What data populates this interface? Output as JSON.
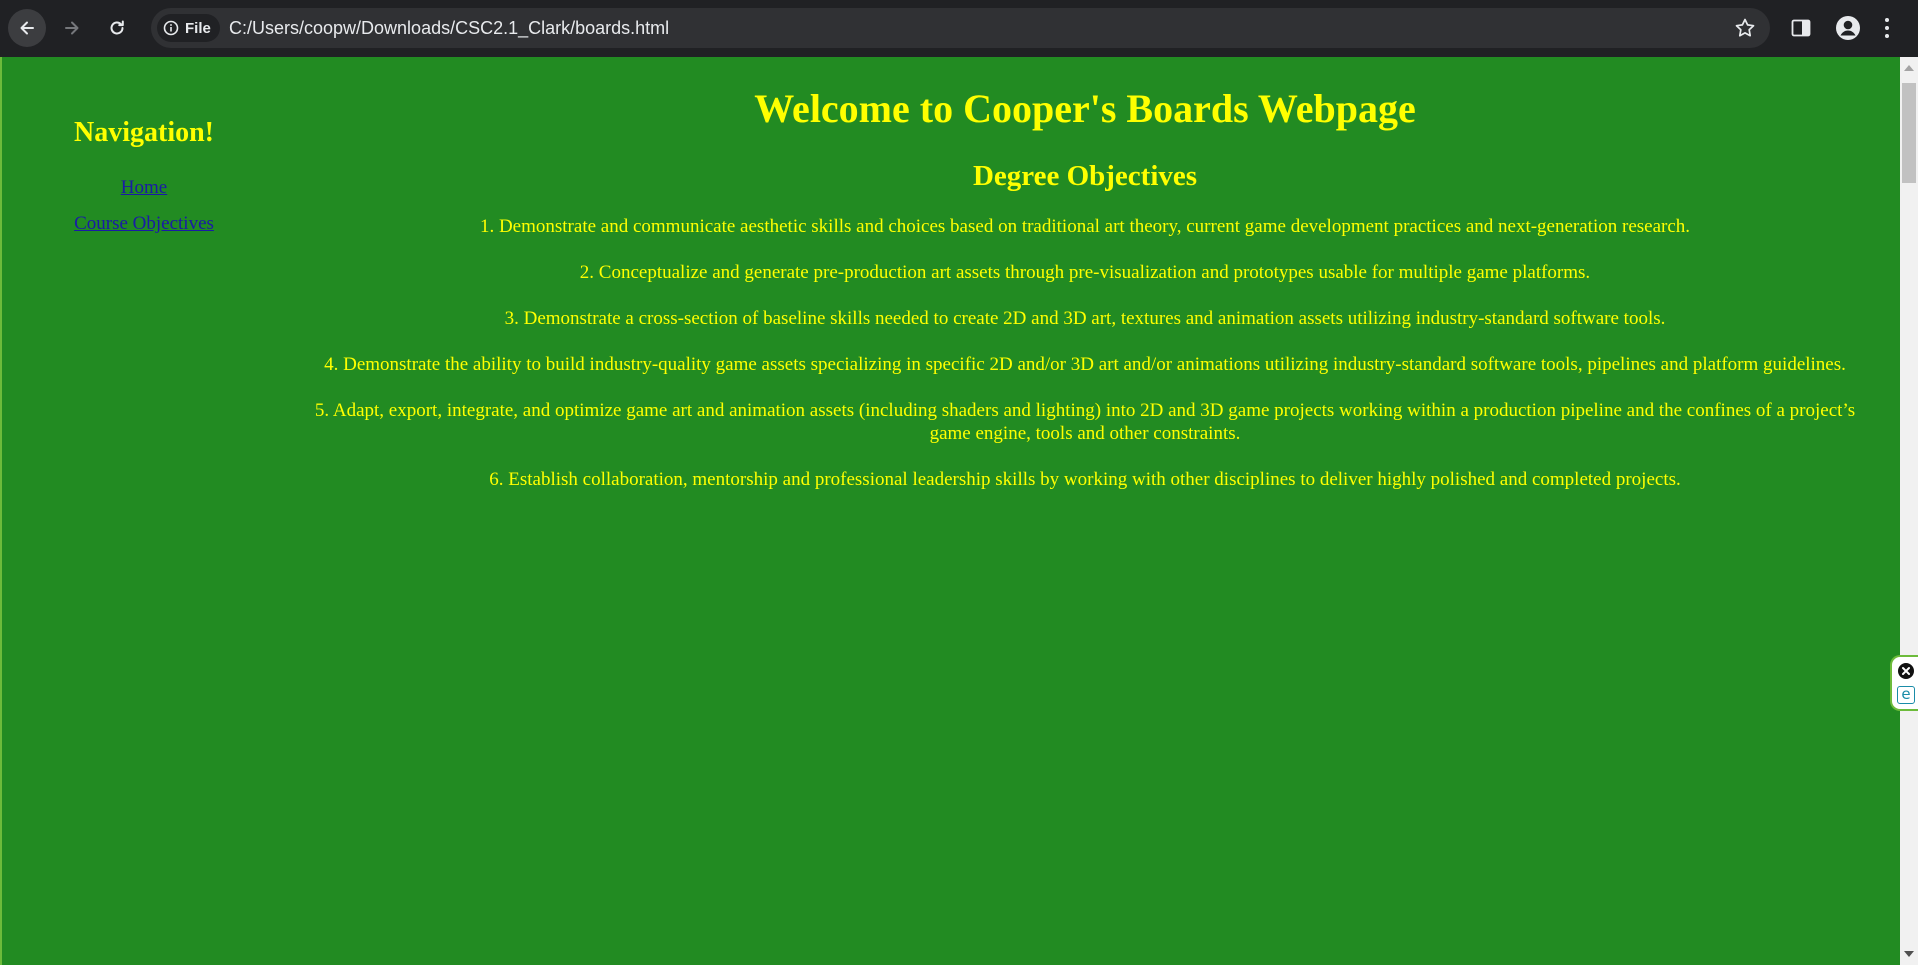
{
  "browser": {
    "chip_label": "File",
    "url": "C:/Users/coopw/Downloads/CSC2.1_Clark/boards.html"
  },
  "icons": {
    "back": "back-arrow-icon",
    "forward": "forward-arrow-icon",
    "reload": "reload-icon",
    "info": "info-icon",
    "bookmark": "star-icon",
    "side_panel": "side-panel-icon",
    "profile": "profile-icon",
    "menu": "kebab-menu-icon",
    "extension_close": "close-icon",
    "extension_logo": "e-logo-icon"
  },
  "sidebar": {
    "heading": "Navigation!",
    "links": [
      {
        "label": "Home"
      },
      {
        "label": "Course Objectives"
      }
    ]
  },
  "main": {
    "title": "Welcome to Cooper's Boards Webpage",
    "section_heading": "Degree Objectives",
    "objectives": [
      "1. Demonstrate and communicate aesthetic skills and choices based on traditional art theory, current game development practices and next-generation research.",
      "2. Conceptualize and generate pre-production art assets through pre-visualization and prototypes usable for multiple game platforms.",
      "3. Demonstrate a cross-section of baseline skills needed to create 2D and 3D art, textures and animation assets utilizing industry-standard software tools.",
      "4. Demonstrate the ability to build industry-quality game assets specializing in specific 2D and/or 3D art and/or animations utilizing industry-standard software tools, pipelines and platform guidelines.",
      "5. Adapt, export, integrate, and optimize game art and animation assets (including shaders and lighting) into 2D and 3D game projects working within a production pipeline and the confines of a project’s game engine, tools and other constraints.",
      "6. Establish collaboration, mentorship and professional leadership skills by working with other disciplines to deliver highly polished and completed projects."
    ]
  },
  "colors": {
    "page_background": "#228b22",
    "heading_text": "#ffff00",
    "link_text": "#1a1aa6",
    "chrome_background": "#202124"
  },
  "extension": {
    "logo_letter": "e"
  }
}
